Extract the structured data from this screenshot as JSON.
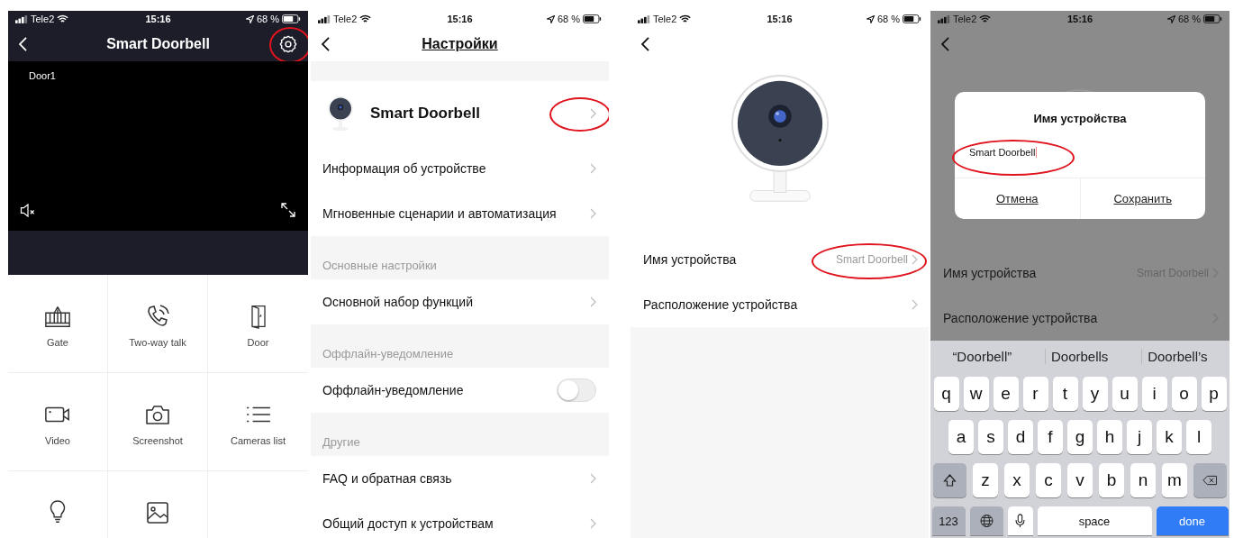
{
  "screens": [
    {
      "kind": "live_view",
      "status_bar": {
        "carrier": "Tele2",
        "time": "15:16",
        "battery": "68 %"
      },
      "title": "Smart Doorbell",
      "settings_circled": true,
      "video": {
        "label": "Door1"
      },
      "actions": [
        {
          "label": "Gate"
        },
        {
          "label": "Two-way talk"
        },
        {
          "label": "Door"
        },
        {
          "label": "Video"
        },
        {
          "label": "Screenshot"
        },
        {
          "label": "Cameras list"
        }
      ]
    },
    {
      "kind": "settings",
      "status_bar": {
        "carrier": "Tele2",
        "time": "15:16",
        "battery": "68 %"
      },
      "title": "Настройки",
      "device": {
        "name": "Smart Doorbell",
        "circled": true
      },
      "groups": [
        {
          "rows": [
            {
              "kind": "link",
              "label": "Информация об устройстве"
            },
            {
              "kind": "link",
              "label": "Мгновенные сценарии и автоматизация"
            }
          ]
        },
        {
          "header": "Основные настройки",
          "rows": [
            {
              "kind": "link",
              "label": "Основной набор функций"
            }
          ]
        },
        {
          "header": "Оффлайн-уведомление",
          "rows": [
            {
              "kind": "toggle",
              "label": "Оффлайн-уведомление",
              "on": false
            }
          ]
        },
        {
          "header": "Другие",
          "rows": [
            {
              "kind": "link",
              "label": "FAQ и обратная связь"
            },
            {
              "kind": "link",
              "label": "Общий доступ к устройствам"
            }
          ]
        }
      ]
    },
    {
      "kind": "device_info",
      "status_bar": {
        "carrier": "Tele2",
        "time": "15:16",
        "battery": "68 %"
      },
      "rows": [
        {
          "label": "Имя устройства",
          "value": "Smart Doorbell",
          "circled": true
        },
        {
          "label": "Расположение устройства",
          "circled": false
        }
      ]
    },
    {
      "kind": "rename",
      "status_bar": {
        "carrier": "Tele2",
        "time": "15:16",
        "battery": "68 %"
      },
      "rows": [
        {
          "label": "Имя устройства",
          "value": "Smart Doorbell"
        },
        {
          "label": "Расположение устройства"
        }
      ],
      "dialog": {
        "title": "Имя устройства",
        "value": "Smart Doorbell",
        "circled": true,
        "buttons": [
          "Отмена",
          "Сохранить"
        ]
      },
      "keyboard": {
        "suggestions": [
          "“Doorbell”",
          "Doorbells",
          "Doorbell’s"
        ],
        "rows": [
          [
            "q",
            "w",
            "e",
            "r",
            "t",
            "y",
            "u",
            "i",
            "o",
            "p"
          ],
          [
            "a",
            "s",
            "d",
            "f",
            "g",
            "h",
            "j",
            "k",
            "l"
          ],
          [
            "z",
            "x",
            "c",
            "v",
            "b",
            "n",
            "m"
          ]
        ],
        "numbers_key": "123",
        "space_key": "space",
        "done_key": "done"
      }
    }
  ]
}
